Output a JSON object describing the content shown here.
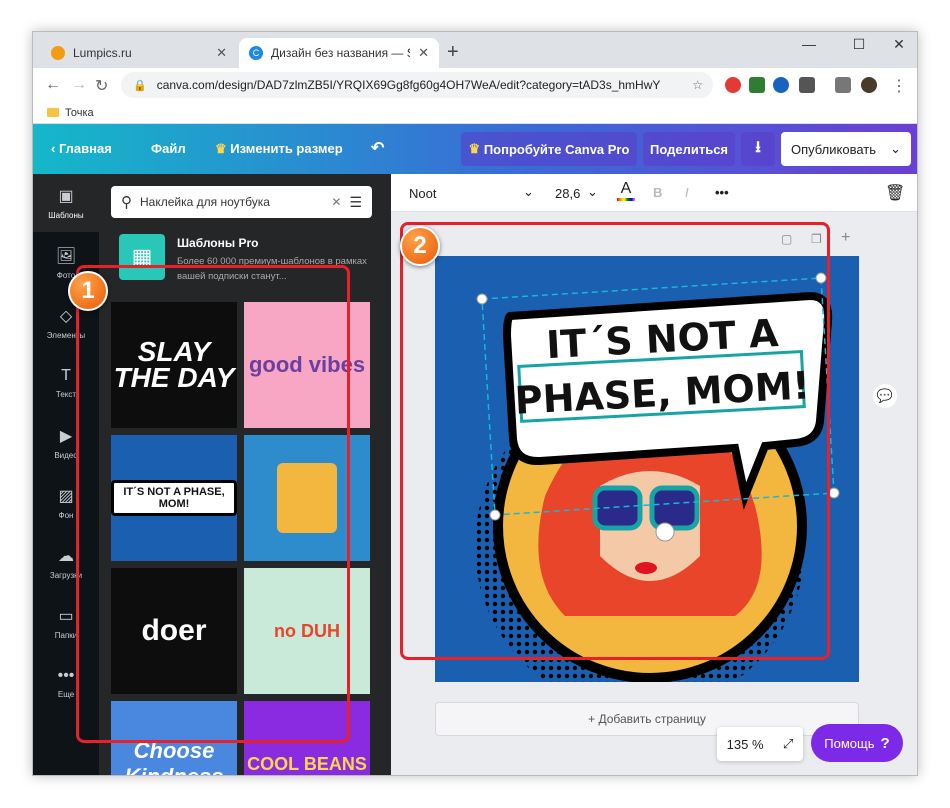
{
  "browser": {
    "tabs": [
      {
        "title": "Lumpics.ru",
        "fav_color": "#f39c12"
      },
      {
        "title": "Дизайн без названия — Square",
        "fav_color": "#1e88e5"
      }
    ],
    "url": "canva.com/design/DAD7zlmZB5I/YRQIX69Gg8fg60g4OH7WeA/edit?category=tAD3s_hmHwY",
    "bookmark": "Точка",
    "window_controls": [
      "minimize-icon",
      "maximize-icon",
      "close-icon"
    ]
  },
  "header": {
    "home": "Главная",
    "file": "Файл",
    "resize": "Изменить размер",
    "try_pro": "Попробуйте Canva Pro",
    "share": "Поделиться",
    "publish": "Опубликовать"
  },
  "sidebar": {
    "items": [
      {
        "label": "Шаблоны",
        "icon": "templates-icon"
      },
      {
        "label": "Фото",
        "icon": "photo-icon"
      },
      {
        "label": "Элементы",
        "icon": "elements-icon"
      },
      {
        "label": "Текст",
        "icon": "text-icon"
      },
      {
        "label": "Видео",
        "icon": "video-icon"
      },
      {
        "label": "Фон",
        "icon": "background-icon"
      },
      {
        "label": "Загрузки",
        "icon": "upload-icon"
      },
      {
        "label": "Папки",
        "icon": "folder-icon"
      },
      {
        "label": "Еще",
        "icon": "more-icon"
      }
    ]
  },
  "panel": {
    "search_value": "Наклейка для ноутбука",
    "pro_title": "Шаблоны Pro",
    "pro_desc": "Более 60 000 премиум-шаблонов в рамках вашей подписки станут...",
    "templates": [
      {
        "text": "SLAY THE DAY",
        "bg": "#0d0d0d"
      },
      {
        "text": "good vibes",
        "bg": "#f7a6c4"
      },
      {
        "text": "IT´S NOT A PHASE, MOM!",
        "bg": "#1a5fb0"
      },
      {
        "text": "",
        "bg": "#2e8ccd"
      },
      {
        "text": "doer",
        "bg": "#0d0d0d"
      },
      {
        "text": "no DUH",
        "bg": "#c9ead9"
      },
      {
        "text": "Choose Kindness",
        "bg": "#4a88e0"
      },
      {
        "text": "COOL BEANS",
        "bg": "#8a2be2"
      }
    ]
  },
  "markers": {
    "one": "1",
    "two": "2"
  },
  "toolbar": {
    "font": "Noot",
    "size": "28,6",
    "bold": "B",
    "italic": "I",
    "more": "•••"
  },
  "design": {
    "line1": "IT´S NOT A",
    "line2": "PHASE, MOM!"
  },
  "editor": {
    "add_page": "+ Добавить страницу",
    "zoom": "135 %",
    "help": "Помощь",
    "help_mark": "?"
  }
}
